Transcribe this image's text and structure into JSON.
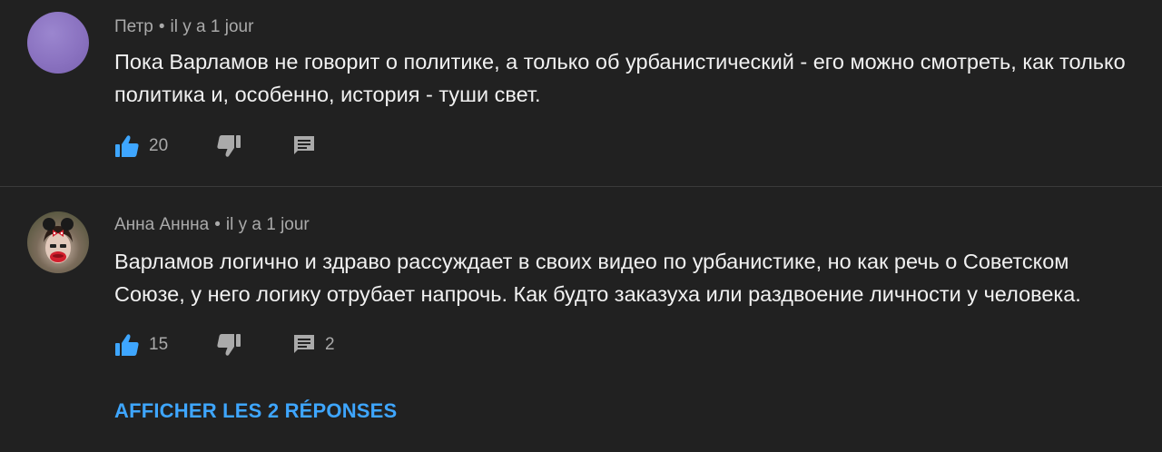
{
  "comments": [
    {
      "author": "Петр",
      "separator": "•",
      "time": "il y a 1 jour",
      "text": "Пока Варламов не говорит о политике, а только об урбанистический - его можно смотреть, как только политика и, особенно, история - туши свет.",
      "likes": "20",
      "replies_count": "",
      "avatar": "purple-avatar"
    },
    {
      "author": "Анна Аннна",
      "separator": "•",
      "time": "il y a 1 jour",
      "text": "Варламов логично и здраво рассуждает в своих видео по урбанистике, но как речь о Советском Союзе, у него логику отрубает напрочь. Как будто заказуха или раздвоение личности у человека.",
      "likes": "15",
      "replies_count": "2",
      "avatar": "photo-avatar"
    }
  ],
  "show_replies_label": "AFFICHER LES 2 RÉPONSES",
  "colors": {
    "background": "#212121",
    "text": "#f1f1f1",
    "secondary_text": "#aaaaaa",
    "accent_blue": "#3ea6ff",
    "like_active": "#3ea6ff",
    "icon_gray": "#aaaaaa"
  },
  "icons": [
    "thumb-up-icon",
    "thumb-down-icon",
    "reply-comment-icon"
  ]
}
